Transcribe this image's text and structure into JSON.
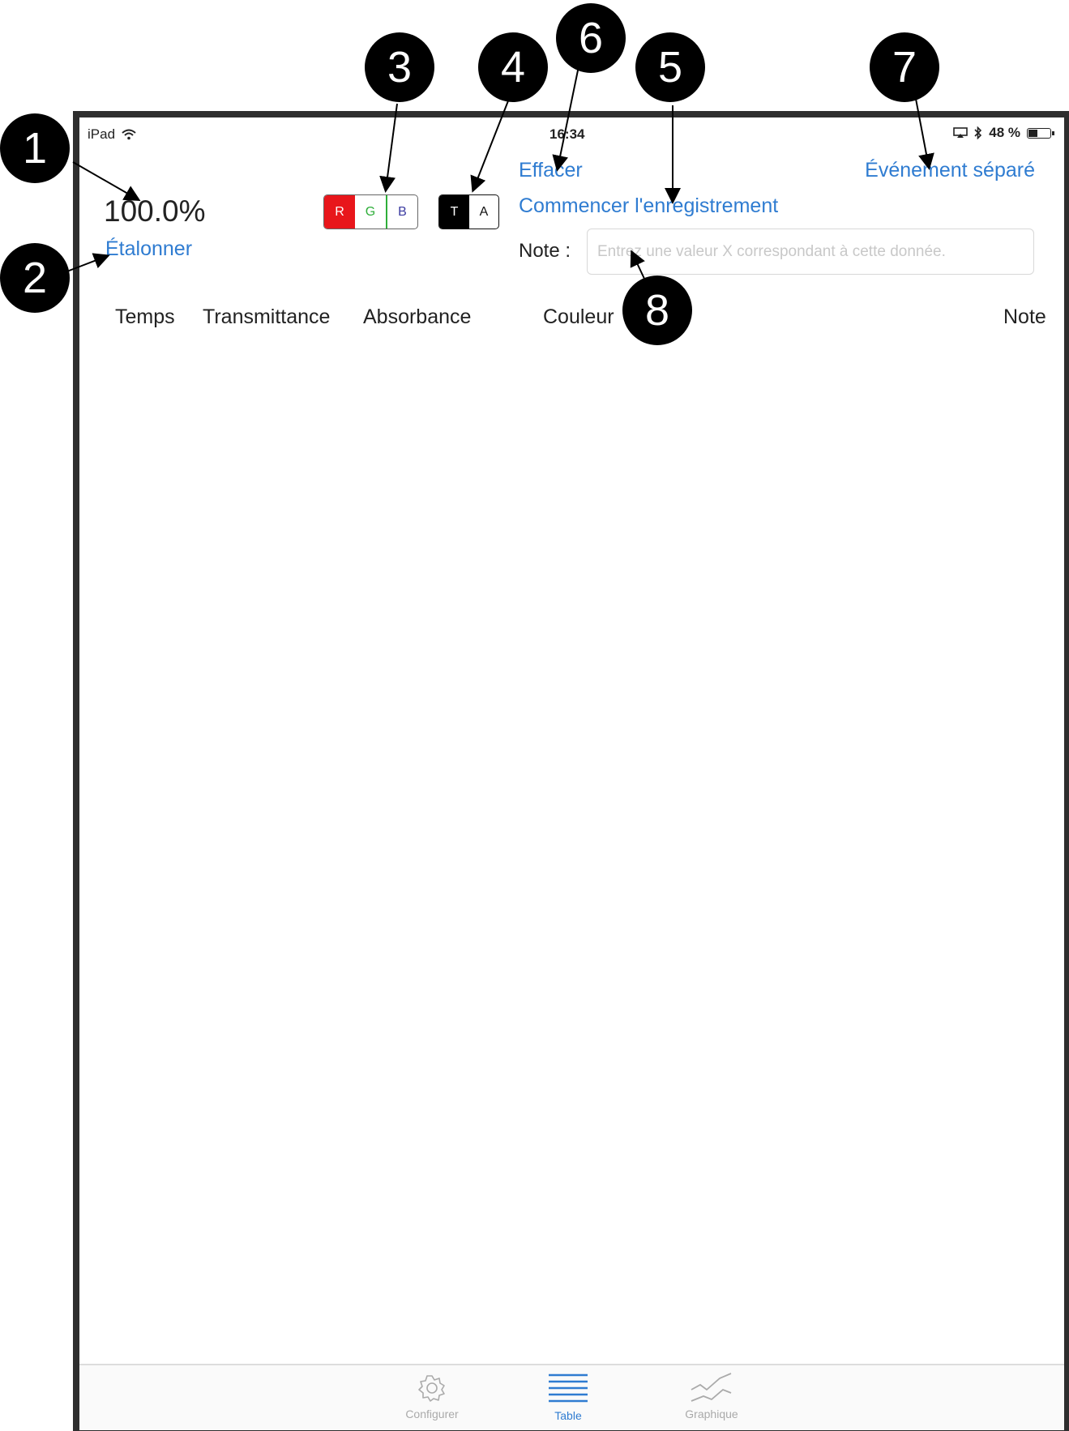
{
  "status_bar": {
    "device": "iPad",
    "time": "16:34",
    "battery": "48 %",
    "battery_level": 0.48
  },
  "reading": {
    "value": "100.0%"
  },
  "calibrate_label": "Étalonner",
  "color_selector": {
    "options": [
      "R",
      "G",
      "B"
    ],
    "selected": "G"
  },
  "mode_selector": {
    "options": [
      "T",
      "A"
    ],
    "selected": "T"
  },
  "actions": {
    "clear": "Effacer",
    "start_recording": "Commencer l'enregistrement",
    "separate_event": "Événement séparé"
  },
  "note": {
    "label": "Note :",
    "placeholder": "Entrez une valeur X correspondant à cette donnée.",
    "value": ""
  },
  "table": {
    "columns": [
      "Temps",
      "Transmittance",
      "Absorbance",
      "Couleur",
      "Note"
    ],
    "rows": []
  },
  "tab_bar": {
    "tabs": [
      {
        "label": "Configurer",
        "icon": "gear-icon",
        "active": false
      },
      {
        "label": "Table",
        "icon": "list-icon",
        "active": true
      },
      {
        "label": "Graphique",
        "icon": "chart-icon",
        "active": false
      }
    ]
  },
  "annotations": [
    "1",
    "2",
    "3",
    "4",
    "5",
    "6",
    "7",
    "8"
  ],
  "colors": {
    "accent": "#2f7cd1",
    "red": "#e8161b",
    "green": "#2fae3a",
    "blue": "#3a3aa0"
  }
}
